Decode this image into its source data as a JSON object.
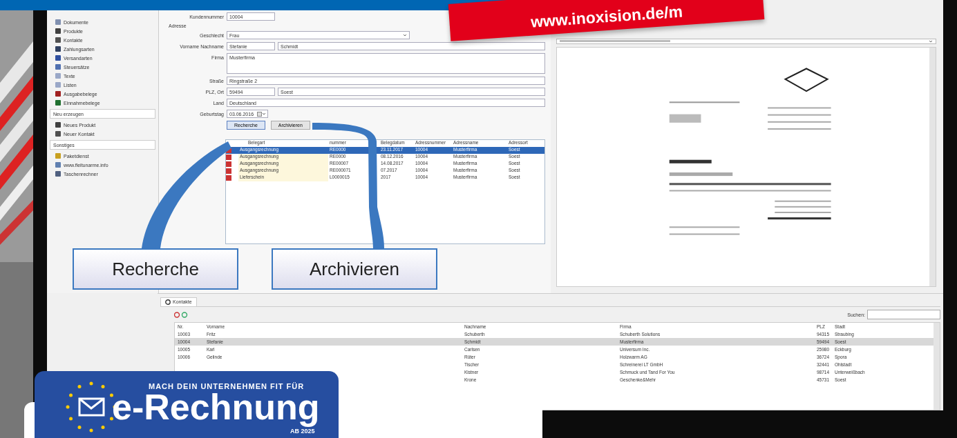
{
  "promo_banner": {
    "text": "www.inoxision.de/m"
  },
  "sidebar": {
    "items": [
      {
        "label": "Dokumente",
        "color": "#8090b0"
      },
      {
        "label": "Produkte",
        "color": "#404040"
      },
      {
        "label": "Kontakte",
        "color": "#505050"
      },
      {
        "label": "Zahlungsarten",
        "color": "#304060"
      },
      {
        "label": "Versandarten",
        "color": "#3050a0"
      },
      {
        "label": "Steuersätze",
        "color": "#5070b0"
      },
      {
        "label": "Texte",
        "color": "#9aa8c8"
      },
      {
        "label": "Listen",
        "color": "#9aa8c8"
      },
      {
        "label": "Ausgabebelege",
        "color": "#a02020"
      },
      {
        "label": "Einnahmebelege",
        "color": "#207030"
      }
    ],
    "sections": [
      {
        "title": "Neu erzeugen",
        "items": [
          {
            "label": "Neues Produkt",
            "color": "#404040"
          },
          {
            "label": "Neuer Kontakt",
            "color": "#505050"
          }
        ]
      },
      {
        "title": "Sonstiges",
        "items": [
          {
            "label": "Paketdienst",
            "color": "#c8a020"
          },
          {
            "label": "www.fleitunarme.info",
            "color": "#6080b0"
          },
          {
            "label": "Taschenrechner",
            "color": "#506080"
          }
        ]
      }
    ]
  },
  "form": {
    "customer_number_label": "Kundennummer",
    "customer_number": "10004",
    "address_heading": "Adresse",
    "fields": [
      {
        "label": "Geschlecht",
        "kind": "select",
        "values": [
          "Frau"
        ]
      },
      {
        "label": "Vorname Nachname",
        "kind": "pair",
        "values": [
          "Stefanie",
          "Schmidt"
        ]
      },
      {
        "label": "Firma",
        "kind": "area",
        "values": [
          "Musterfirma"
        ]
      },
      {
        "label": "Straße",
        "kind": "text",
        "values": [
          "Ringstraße 2"
        ]
      },
      {
        "label": "PLZ, Ort",
        "kind": "pair",
        "values": [
          "59494",
          "Soest"
        ]
      },
      {
        "label": "Land",
        "kind": "text",
        "values": [
          "Deutschland"
        ]
      },
      {
        "label": "Geburtstag",
        "kind": "date",
        "values": [
          "03.06.2016"
        ]
      }
    ],
    "buttons": [
      "Recherche",
      "Archivieren"
    ]
  },
  "documents": {
    "columns": [
      "Belegart",
      "nummer",
      "Belegdatum",
      "Adressnummer",
      "Adressname",
      "Adressort"
    ],
    "rows": [
      {
        "selected": true,
        "cells": [
          "Ausgangsrechnung",
          "RE0000",
          "23.11.2017",
          "10004",
          "Musterfirma",
          "Soest"
        ]
      },
      {
        "selected": false,
        "cells": [
          "Ausgangsrechnung",
          "RE0000",
          "08.12.2016",
          "10004",
          "Musterfirma",
          "Soest"
        ]
      },
      {
        "selected": false,
        "cells": [
          "Ausgangsrechnung",
          "RE00007",
          "14.08.2017",
          "10004",
          "Musterfirma",
          "Soest"
        ]
      },
      {
        "selected": false,
        "cells": [
          "Ausgangsrechnung",
          "RE000071",
          "07.2017",
          "10004",
          "Musterfirma",
          "Soest"
        ]
      },
      {
        "selected": false,
        "cells": [
          "Lieferschein",
          "L0000015",
          "2017",
          "10004",
          "Musterfirma",
          "Soest"
        ]
      }
    ]
  },
  "callouts": [
    "Recherche",
    "Archivieren"
  ],
  "contacts_panel": {
    "tab": "Kontakte",
    "search_label": "Suchen:",
    "columns": [
      "Nr.",
      "Vorname",
      "Nachname",
      "Firma",
      "PLZ",
      "Stadt"
    ],
    "rows": [
      {
        "selected": false,
        "cells": [
          "10003",
          "Fritz",
          "Schuberth",
          "Schuberth Solutions",
          "94315",
          "Straubing"
        ]
      },
      {
        "selected": true,
        "cells": [
          "10004",
          "Stefanie",
          "Schmidt",
          "Musterfirma",
          "59494",
          "Soest"
        ]
      },
      {
        "selected": false,
        "cells": [
          "10005",
          "Karl",
          "Carlsen",
          "Universum Inc.",
          "25980",
          "Eckburg"
        ]
      },
      {
        "selected": false,
        "cells": [
          "10006",
          "Gelinde",
          "Rüter",
          "Holzwarm AG",
          "36724",
          "Spora"
        ]
      },
      {
        "selected": false,
        "cells": [
          "",
          "",
          "Tischer",
          "Schreinerei LT GmbH",
          "32441",
          "Ohlstadt"
        ]
      },
      {
        "selected": false,
        "cells": [
          "",
          "",
          "Kistner",
          "Schmuck und Tand For You",
          "98714",
          "Unterweißbach"
        ]
      },
      {
        "selected": false,
        "cells": [
          "",
          "",
          "Krone",
          "Geschenke&Mehr",
          "45731",
          "Soest"
        ]
      }
    ]
  },
  "badge": {
    "tagline": "MACH DEIN UNTERNEHMEN FIT FÜR",
    "title": "e-Rechnung",
    "subtitle": "AB 2025"
  }
}
